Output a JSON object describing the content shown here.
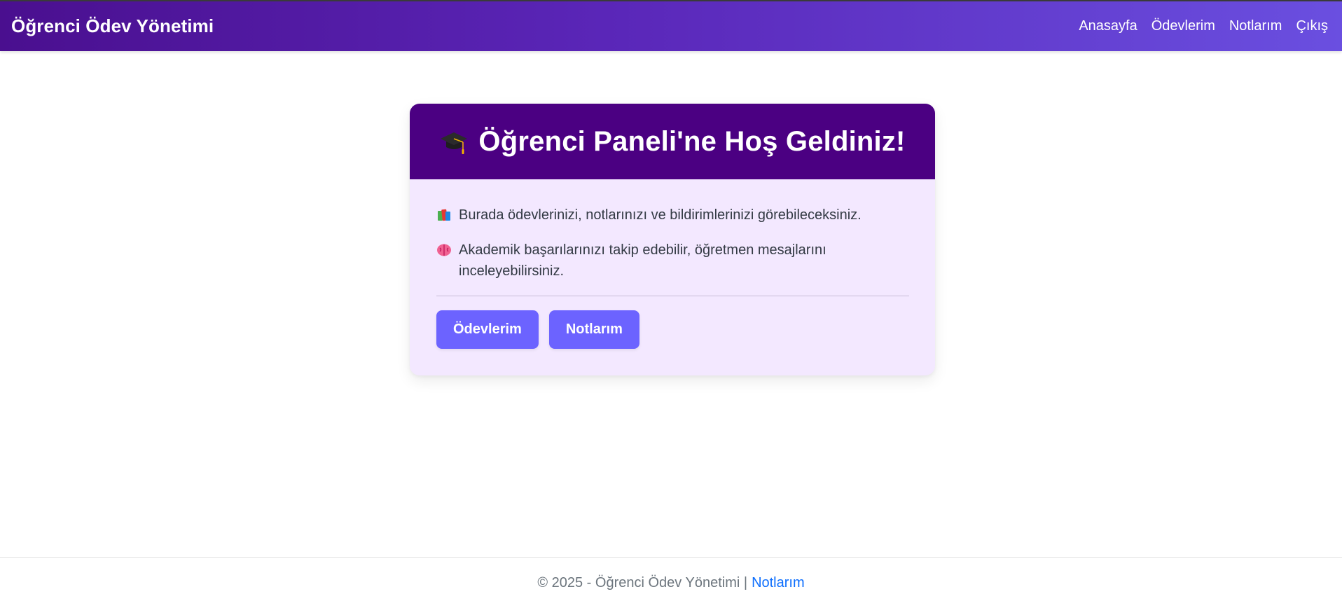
{
  "navbar": {
    "brand": "Öğrenci Ödev Yönetimi",
    "links": [
      "Anasayfa",
      "Ödevlerim",
      "Notlarım",
      "Çıkış"
    ]
  },
  "welcome_card": {
    "title_icon": "graduation-cap-icon",
    "title": "Öğrenci Paneli'ne Hoş Geldiniz!",
    "lines": [
      {
        "icon": "books-icon",
        "text": "Burada ödevlerinizi, notlarınızı ve bildirimlerinizi görebileceksiniz."
      },
      {
        "icon": "brain-icon",
        "text": "Akademik başarılarınızı takip edebilir, öğretmen mesajlarını inceleyebilirsiniz."
      }
    ],
    "buttons": [
      "Ödevlerim",
      "Notlarım"
    ]
  },
  "footer": {
    "text": "© 2025 - Öğrenci Ödev Yönetimi |",
    "link": "Notlarım"
  },
  "colors": {
    "navbar_start": "#4a0f8f",
    "navbar_end": "#6a4fe0",
    "card_header": "#4b0082",
    "card_body": "#f3e8ff",
    "button": "#6c63ff",
    "footer_link": "#0d6efd"
  }
}
